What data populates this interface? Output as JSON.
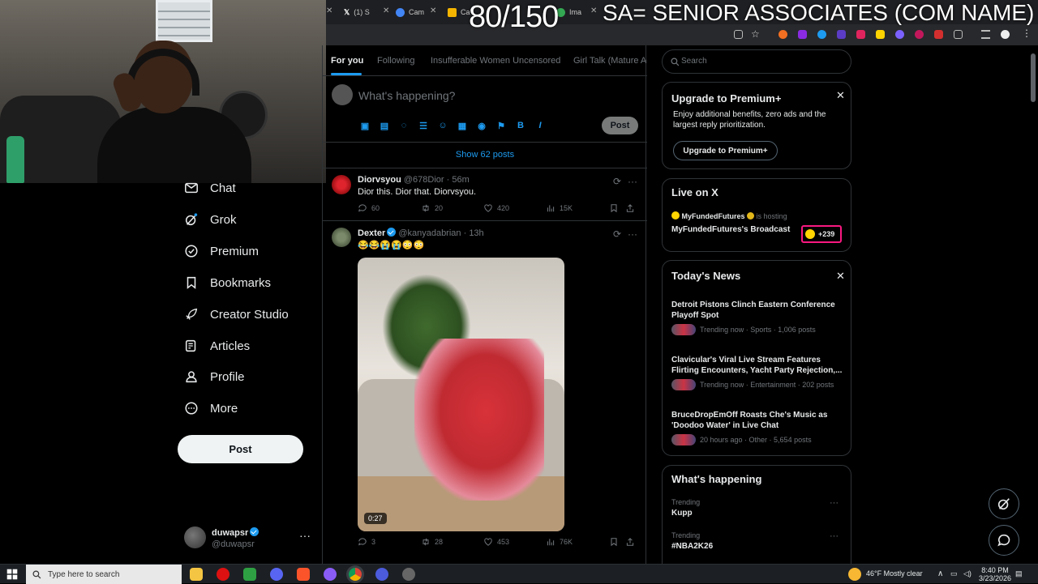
{
  "overlay": {
    "count": "80/150",
    "title": "SA= SENIOR ASSOCIATES (COM NAME)"
  },
  "browser": {
    "tabs": [
      {
        "label": "(1) S",
        "color": "#ffffff"
      },
      {
        "label": "Cam",
        "color": "#4285f4"
      },
      {
        "label": "Ca",
        "color": "#f4b400"
      },
      {
        "label": "Ima",
        "color": "#34a853"
      }
    ]
  },
  "nav": {
    "items": [
      {
        "label": "Chat",
        "icon": "chat-icon"
      },
      {
        "label": "Grok",
        "icon": "grok-icon"
      },
      {
        "label": "Premium",
        "icon": "premium-icon"
      },
      {
        "label": "Bookmarks",
        "icon": "bookmark-icon"
      },
      {
        "label": "Creator Studio",
        "icon": "rocket-icon"
      },
      {
        "label": "Articles",
        "icon": "articles-icon"
      },
      {
        "label": "Profile",
        "icon": "profile-icon"
      },
      {
        "label": "More",
        "icon": "more-icon"
      }
    ],
    "post_label": "Post"
  },
  "account": {
    "name": "duwapsr",
    "handle": "@duwapsr"
  },
  "feed": {
    "tabs": [
      "For you",
      "Following",
      "Insufferable Women Uncensored",
      "Girl Talk (Mature Ad"
    ],
    "compose_placeholder": "What's happening?",
    "compose_post": "Post",
    "show_posts": "Show 62 posts",
    "tweets": [
      {
        "name": "Diorvsyou",
        "handle": "@678Dior",
        "time": "· 56m",
        "text": "Dior this. Dior that. Diorvsyou.",
        "replies": "60",
        "reposts": "20",
        "likes": "420",
        "views": "15K"
      },
      {
        "name": "Dexter",
        "handle": "@kanyadabrian",
        "time": "· 13h",
        "text": "😂😂😭😭😳😳",
        "duration": "0:27",
        "replies": "3",
        "reposts": "28",
        "likes": "453",
        "views": "76K"
      }
    ]
  },
  "sidebar": {
    "search_placeholder": "Search",
    "premium": {
      "title": "Upgrade to Premium+",
      "body": "Enjoy additional benefits, zero ads and the largest reply prioritization.",
      "button": "Upgrade to Premium+"
    },
    "live": {
      "title": "Live on X",
      "host": "MyFundedFutures",
      "hosting": "is hosting",
      "broadcast": "MyFundedFutures's Broadcast",
      "listeners": "+239"
    },
    "news": {
      "title": "Today's News",
      "items": [
        {
          "headline": "Detroit Pistons Clinch Eastern Conference Playoff Spot",
          "meta": "Trending now · Sports · 1,006 posts"
        },
        {
          "headline": "Clavicular's Viral Live Stream Features Flirting Encounters, Yacht Party Rejection,...",
          "meta": "Trending now · Entertainment · 202 posts"
        },
        {
          "headline": "BruceDropEmOff Roasts Che's Music as 'Doodoo Water' in Live Chat",
          "meta": "20 hours ago · Other · 5,654 posts"
        }
      ]
    },
    "happening": {
      "title": "What's happening",
      "items": [
        {
          "context": "Trending",
          "topic": "Kupp"
        },
        {
          "context": "Trending",
          "topic": "#NBA2K26"
        }
      ]
    }
  },
  "taskbar": {
    "search_placeholder": "Type here to search",
    "weather": "46°F  Mostly clear",
    "time": "8:40 PM",
    "date": "3/23/2026"
  },
  "colors": {
    "accent": "#1d9bf0",
    "background": "#000000",
    "border": "#2f3336",
    "muted": "#71767b",
    "live_highlight": "#f91880"
  }
}
